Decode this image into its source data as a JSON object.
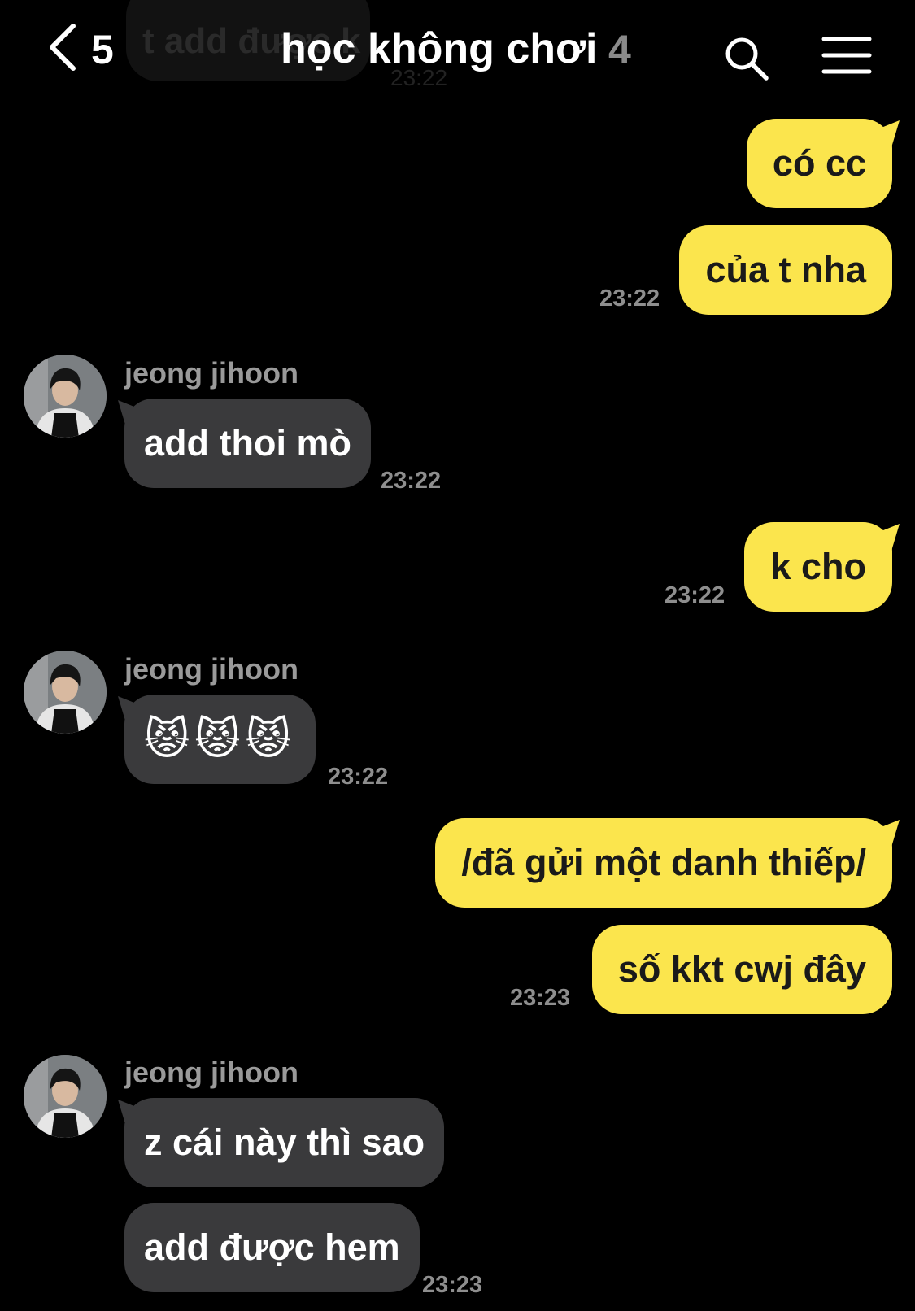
{
  "header": {
    "background_hint_text": "t add được k",
    "background_hint_time": "23:22",
    "back_count": "5",
    "title": "học không chơi",
    "member_count": "4"
  },
  "colors": {
    "my_bubble": "#fbe54d",
    "their_bubble": "#3a3a3c",
    "background": "#000000",
    "timestamp": "#8e8e8e"
  },
  "messages": [
    {
      "from": "me",
      "text": "có cc"
    },
    {
      "from": "me",
      "text": "của t nha",
      "time": "23:22"
    },
    {
      "from": "jeong jihoon",
      "sender": "jeong jihoon",
      "text": "add thoi mò",
      "time": "23:22"
    },
    {
      "from": "me",
      "text": "k cho",
      "time": "23:22"
    },
    {
      "from": "jeong jihoon",
      "sender": "jeong jihoon",
      "text": "😾😾😾",
      "time": "23:22"
    },
    {
      "from": "me",
      "text": "/đã gửi một danh thiếp/"
    },
    {
      "from": "me",
      "text": "số kkt cwj đây",
      "time": "23:23"
    },
    {
      "from": "jeong jihoon",
      "sender": "jeong jihoon",
      "text": "z cái này thì sao"
    },
    {
      "from": "jeong jihoon",
      "text": "add được hem",
      "time": "23:23"
    }
  ]
}
